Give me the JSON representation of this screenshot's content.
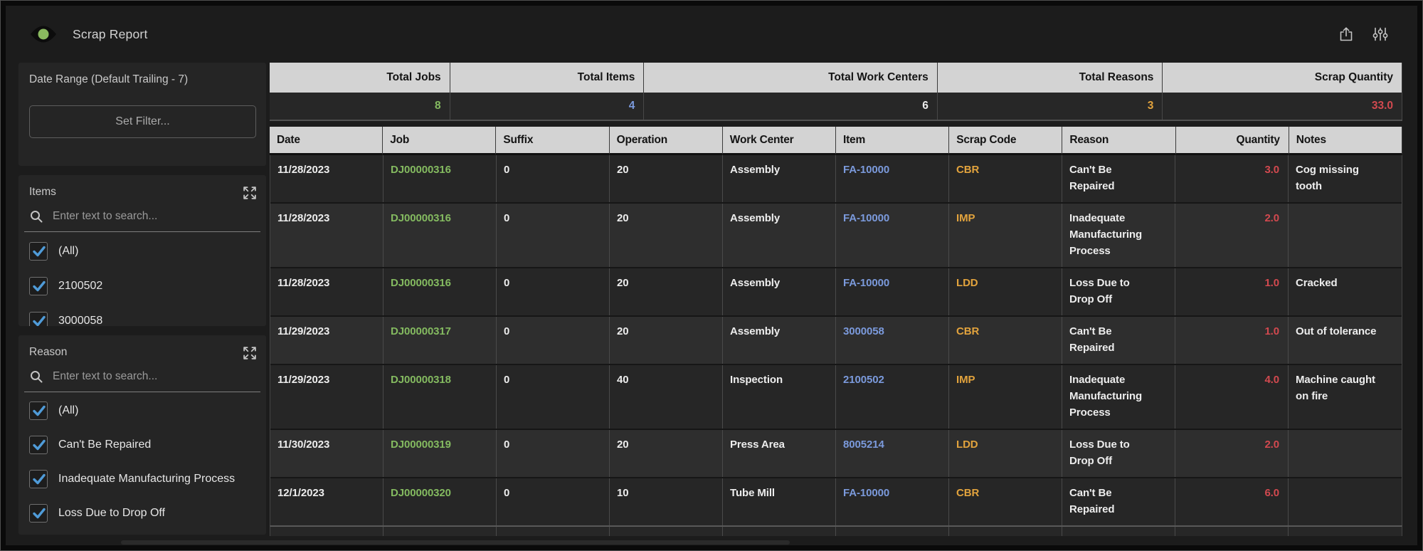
{
  "app": {
    "title": "Scrap Report"
  },
  "toolbar": {
    "export_icon": "export-share",
    "settings_icon": "filter-sliders"
  },
  "sidebar": {
    "date_range": {
      "title": "Date Range (Default Trailing - 7)",
      "button_label": "Set Filter..."
    },
    "items_filter": {
      "title": "Items",
      "search_placeholder": "Enter text to search...",
      "options": [
        {
          "label": "(All)",
          "checked": true
        },
        {
          "label": "2100502",
          "checked": true
        },
        {
          "label": "3000058",
          "checked": true
        }
      ]
    },
    "reason_filter": {
      "title": "Reason",
      "search_placeholder": "Enter text to search...",
      "options": [
        {
          "label": "(All)",
          "checked": true
        },
        {
          "label": "Can't Be Repaired",
          "checked": true
        },
        {
          "label": "Inadequate Manufacturing Process",
          "checked": true
        },
        {
          "label": "Loss Due to Drop Off",
          "checked": true
        }
      ]
    }
  },
  "summary": {
    "columns": [
      {
        "label": "Total Jobs",
        "value": "8",
        "color": "#84ba60"
      },
      {
        "label": "Total Items",
        "value": "4",
        "color": "#7b9adc"
      },
      {
        "label": "Total Work Centers",
        "value": "6",
        "color": "#ededed"
      },
      {
        "label": "Total Reasons",
        "value": "3",
        "color": "#e2a33d"
      },
      {
        "label": "Scrap Quantity",
        "value": "33.0",
        "color": "#d2494f"
      }
    ]
  },
  "table": {
    "columns": [
      "Date",
      "Job",
      "Suffix",
      "Operation",
      "Work Center",
      "Item",
      "Scrap Code",
      "Reason",
      "Quantity",
      "Notes"
    ],
    "rows": [
      {
        "date": "11/28/2023",
        "job": "DJ00000316",
        "suffix": "0",
        "operation": "20",
        "work_center": "Assembly",
        "item": "FA-10000",
        "scrap_code": "CBR",
        "reason": "Can't Be\nRepaired",
        "quantity": "3.0",
        "notes": "Cog missing\ntooth"
      },
      {
        "date": "11/28/2023",
        "job": "DJ00000316",
        "suffix": "0",
        "operation": "20",
        "work_center": "Assembly",
        "item": "FA-10000",
        "scrap_code": "IMP",
        "reason": "Inadequate\nManufacturing\nProcess",
        "quantity": "2.0",
        "notes": ""
      },
      {
        "date": "11/28/2023",
        "job": "DJ00000316",
        "suffix": "0",
        "operation": "20",
        "work_center": "Assembly",
        "item": "FA-10000",
        "scrap_code": "LDD",
        "reason": "Loss Due to\nDrop Off",
        "quantity": "1.0",
        "notes": "Cracked"
      },
      {
        "date": "11/29/2023",
        "job": "DJ00000317",
        "suffix": "0",
        "operation": "20",
        "work_center": "Assembly",
        "item": "3000058",
        "scrap_code": "CBR",
        "reason": "Can't Be\nRepaired",
        "quantity": "1.0",
        "notes": "Out of tolerance"
      },
      {
        "date": "11/29/2023",
        "job": "DJ00000318",
        "suffix": "0",
        "operation": "40",
        "work_center": "Inspection",
        "item": "2100502",
        "scrap_code": "IMP",
        "reason": "Inadequate\nManufacturing\nProcess",
        "quantity": "4.0",
        "notes": "Machine caught\non fire"
      },
      {
        "date": "11/30/2023",
        "job": "DJ00000319",
        "suffix": "0",
        "operation": "20",
        "work_center": "Press Area",
        "item": "8005214",
        "scrap_code": "LDD",
        "reason": "Loss Due to\nDrop Off",
        "quantity": "2.0",
        "notes": ""
      },
      {
        "date": "12/1/2023",
        "job": "DJ00000320",
        "suffix": "0",
        "operation": "10",
        "work_center": "Tube Mill",
        "item": "FA-10000",
        "scrap_code": "CBR",
        "reason": "Can't Be\nRepaired",
        "quantity": "6.0",
        "notes": ""
      }
    ]
  },
  "colors": {
    "job_link": "#84ba60",
    "item_link": "#7b9adc",
    "scrap_code": "#e2a33d",
    "quantity": "#d2494f",
    "logo_pupil": "#8aba5f",
    "checkbox_check": "#4f9bd8"
  }
}
